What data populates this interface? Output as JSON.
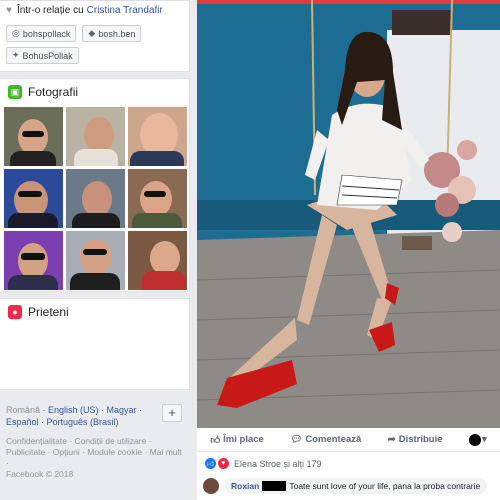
{
  "relationship": {
    "prefix": "Într-o relație cu",
    "partner": "Cristina Trandafir"
  },
  "social": {
    "instagram": "bohspollack",
    "snapchat": "bosh.ben",
    "twitter": "BohusPollak"
  },
  "photos_section": {
    "title": "Fotografii"
  },
  "friends_section": {
    "title": "Prieteni"
  },
  "languages": {
    "current": "Română",
    "others": [
      "English (US)",
      "Magyar",
      "Español",
      "Português (Brasil)"
    ],
    "more_button": "+"
  },
  "footer": {
    "links": [
      "Confidențialitate",
      "Condiții de utilizare",
      "Publicitate",
      "Opțiuni",
      "Module cookie",
      "Mai mult"
    ],
    "copyright": "Facebook © 2018"
  },
  "actions": {
    "like": "Îmi place",
    "comment": "Comentează",
    "share": "Distribuie"
  },
  "reactions": {
    "text": "Elena Stroe și alți 179"
  },
  "comment": {
    "author": "Roxian",
    "text": "Toate sunt love of your life, pana la proba contrarie"
  },
  "colors": {
    "accent": "#385898",
    "photos_icon": "#42b72a",
    "friends_icon": "#f02849",
    "like_blue": "#1877f2"
  }
}
